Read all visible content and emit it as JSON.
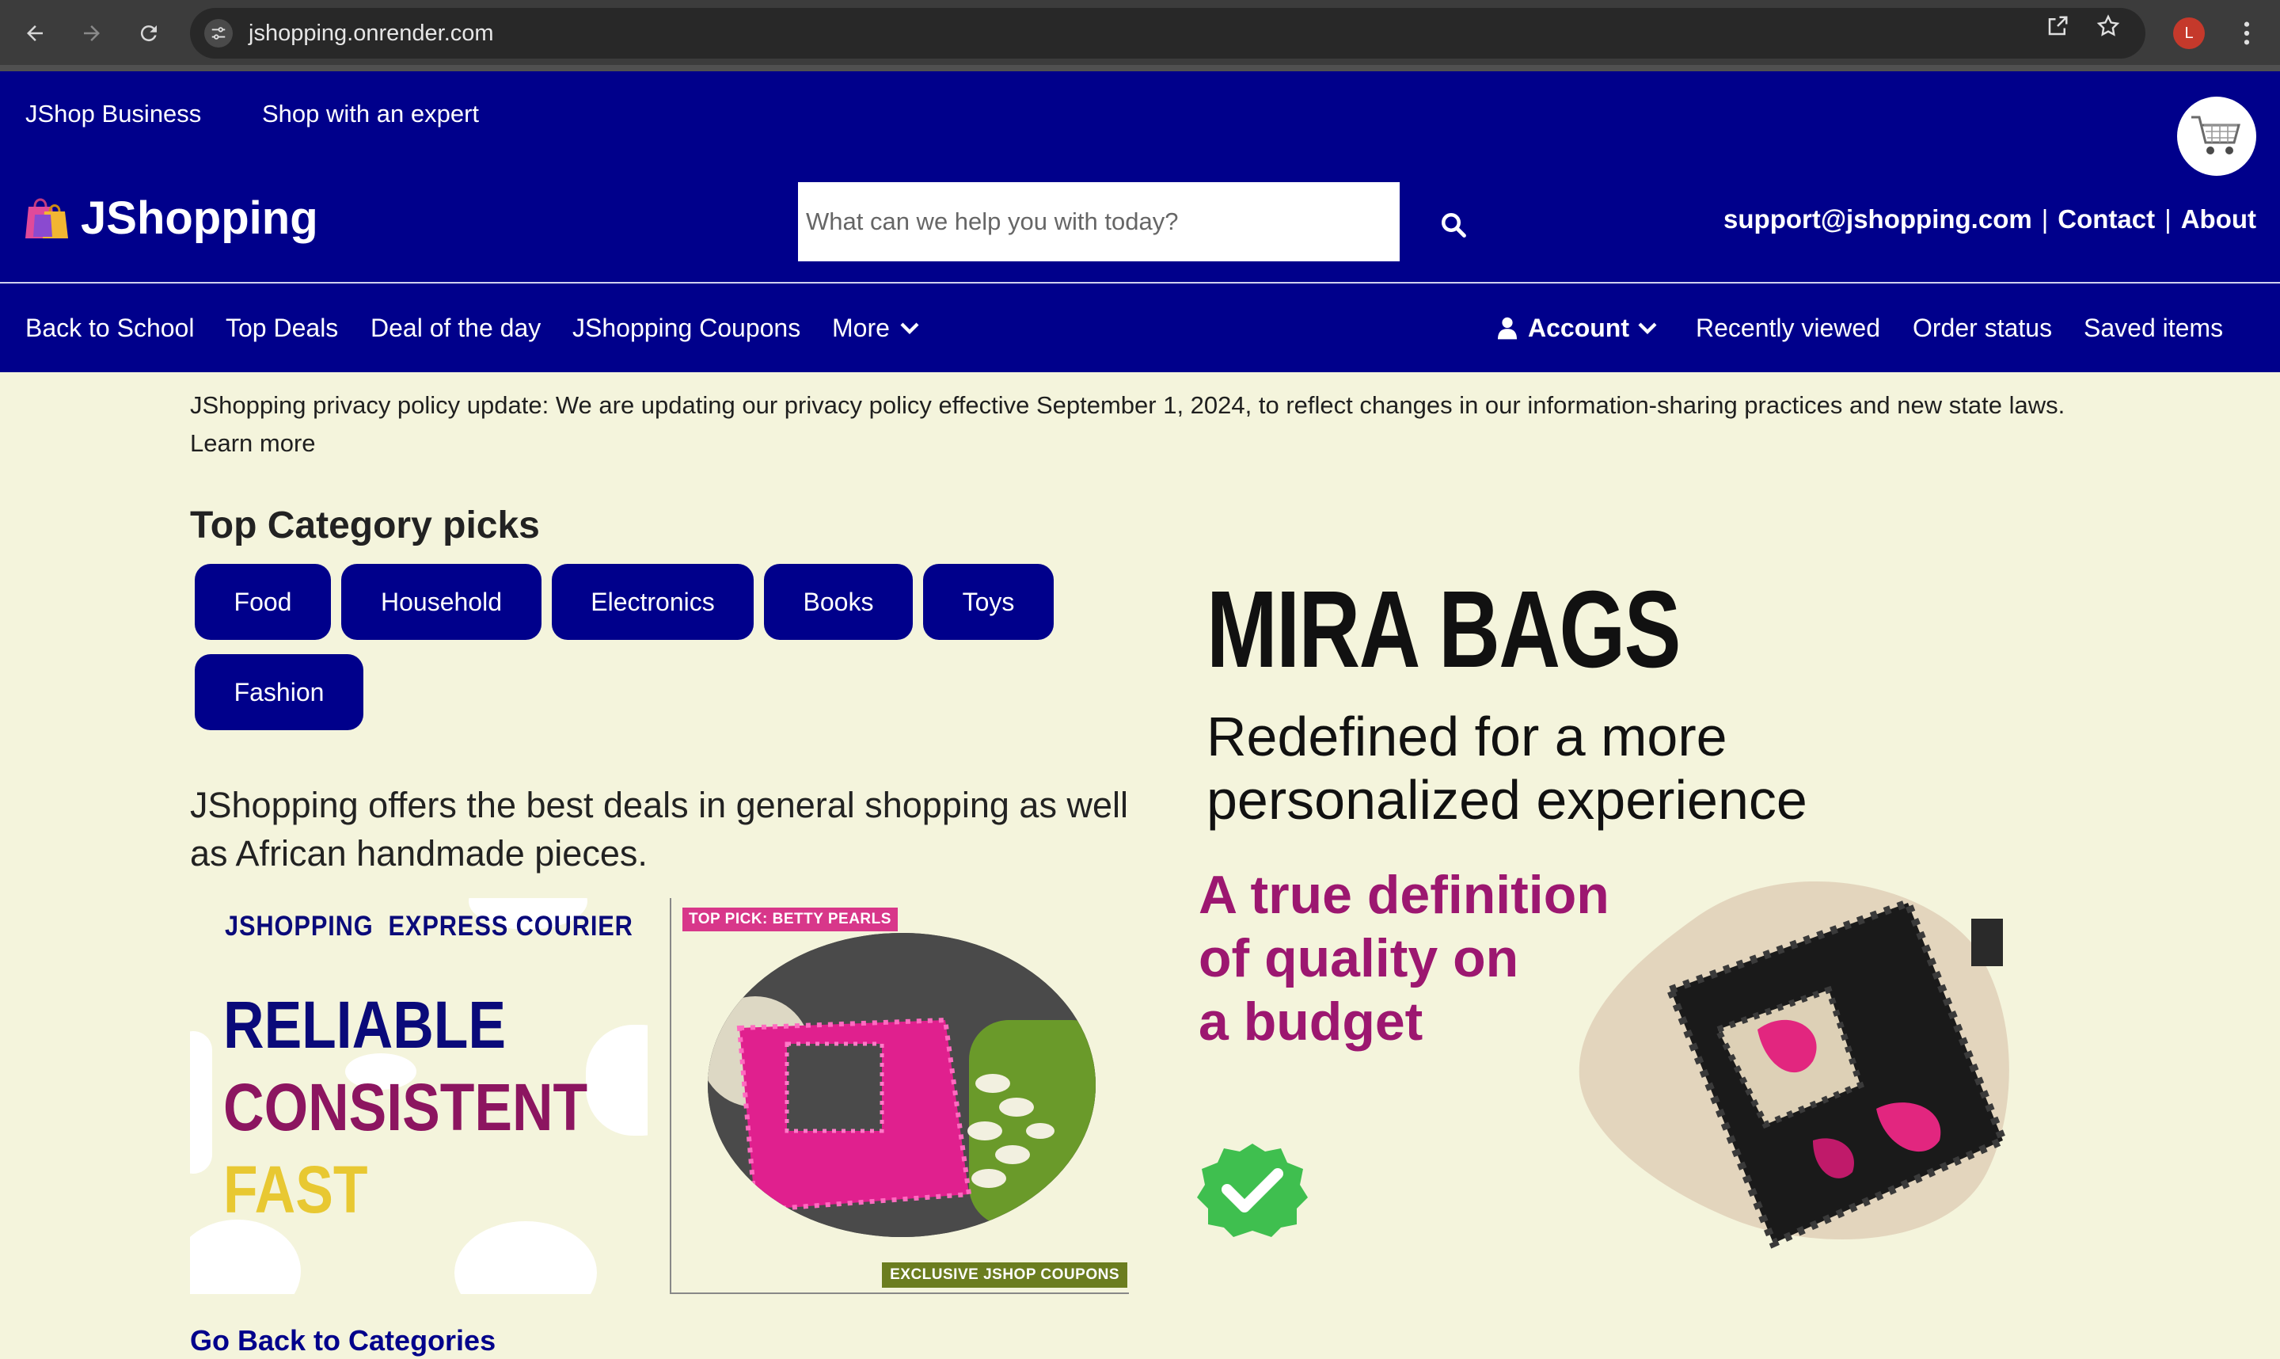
{
  "browser": {
    "url": "jshopping.onrender.com",
    "profile_initial": "L",
    "icons": [
      "back-arrow-icon",
      "forward-arrow-icon",
      "reload-icon",
      "site-settings-icon",
      "open-external-icon",
      "bookmark-star-icon",
      "more-vert-icon"
    ]
  },
  "header": {
    "top_links": [
      "JShop Business",
      "Shop with an expert"
    ],
    "brand": "JShopping",
    "search": {
      "placeholder": "What can we help you with today?"
    },
    "contact": {
      "email": "support@jshopping.com",
      "contact": "Contact",
      "about": "About",
      "separator": "|"
    },
    "nav_left": [
      "Back to School",
      "Top Deals",
      "Deal of the day",
      "JShopping Coupons",
      "More"
    ],
    "nav_right": {
      "account": "Account",
      "recent": "Recently viewed",
      "orders": "Order status",
      "saved": "Saved items"
    },
    "colors": {
      "brand": "#00008b"
    }
  },
  "notice": "JShopping privacy policy update: We are updating our privacy policy effective September 1, 2024, to reflect changes in our information-sharing practices and new state laws. Learn more",
  "categories": {
    "title": "Top Category picks",
    "items": [
      "Food",
      "Household",
      "Electronics",
      "Books",
      "Toys",
      "Fashion"
    ]
  },
  "tagline": "JShopping offers the best deals in general shopping as well as African handmade pieces.",
  "courier_banner": {
    "heading": "JSHOPPING  EXPRESS COURIER",
    "words": [
      "RELIABLE",
      "CONSISTENT",
      "FAST"
    ],
    "colors": {
      "navy": "#0a0a7a",
      "magenta": "#8c1560",
      "yellow": "#e8c832"
    }
  },
  "pearls_banner": {
    "top_tag": "TOP PICK: BETTY PEARLS",
    "bottom_tag": "EXCLUSIVE JSHOP COUPONS"
  },
  "promo": {
    "title": "MIRA BAGS",
    "subtitle": [
      "Redefined for a more",
      "personalized experience"
    ],
    "quality": [
      "A true definition",
      "of quality on",
      "a budget"
    ],
    "colors": {
      "quality": "#9c1770",
      "verified": "#3fbf4f"
    }
  },
  "footer_link": "Go Back to Categories"
}
